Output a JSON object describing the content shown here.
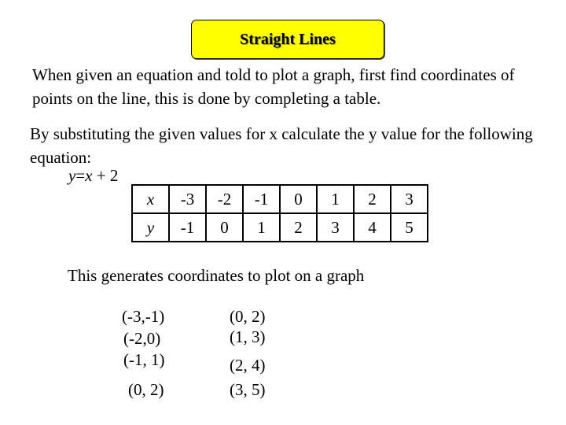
{
  "title": "Straight Lines",
  "intro": "When given an equation and told to plot a graph, first find coordinates of points on the line, this is done by completing a table.",
  "instruction": "By substituting the given values for x calculate the y value for the following equation:",
  "equation": {
    "lhs": "y",
    "equals": "=",
    "rhs_var": "x",
    "plus": "+",
    "constant": "2"
  },
  "table": {
    "x_label": "x",
    "y_label": "y",
    "x_values": [
      "-3",
      "-2",
      "-1",
      "0",
      "1",
      "2",
      "3"
    ],
    "y_values": [
      "-1",
      "0",
      "1",
      "2",
      "3",
      "4",
      "5"
    ]
  },
  "generates_text": "This generates coordinates to plot on a graph",
  "coordinates": {
    "left": [
      "(-3,-1)",
      "(-2,0)",
      "(-1, 1)",
      "(0, 2)"
    ],
    "right": [
      "(0, 2)",
      "(1, 3)",
      "(2, 4)",
      "(3, 5)"
    ]
  },
  "colors": {
    "title_background": "#ffff00",
    "text": "#000000"
  }
}
